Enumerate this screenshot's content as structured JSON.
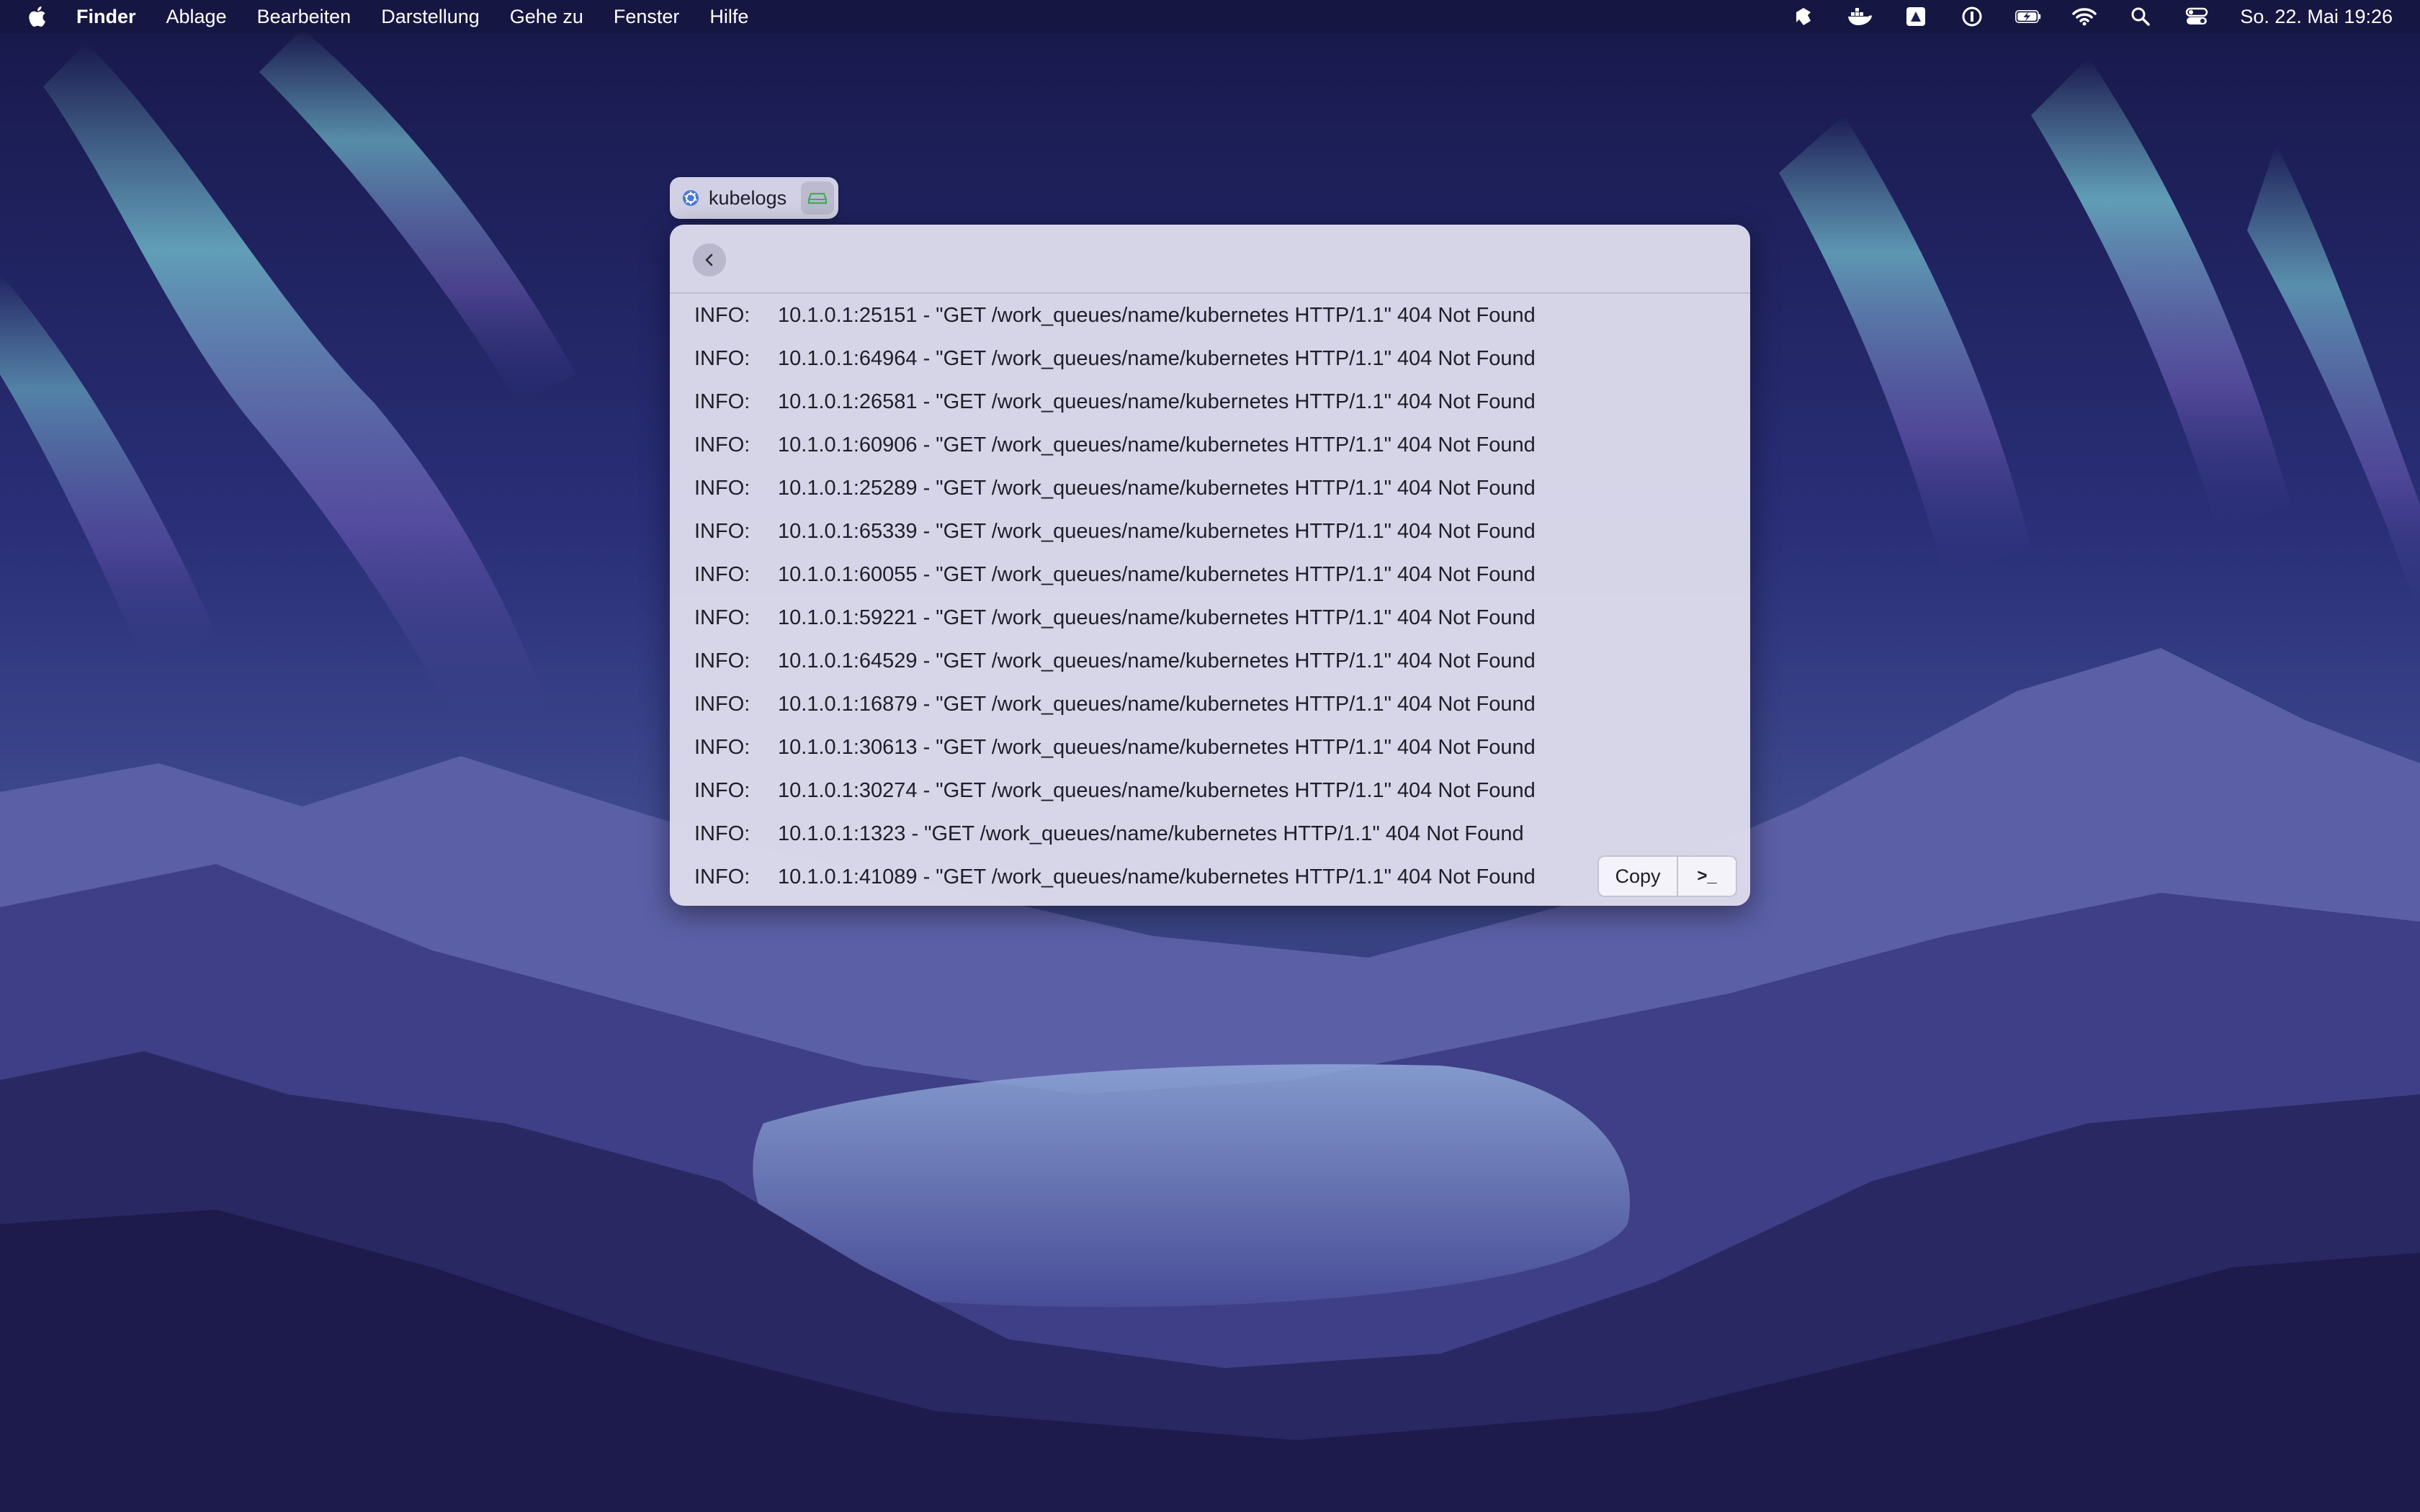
{
  "menubar": {
    "app_name": "Finder",
    "items": [
      "Ablage",
      "Bearbeiten",
      "Darstellung",
      "Gehe zu",
      "Fenster",
      "Hilfe"
    ],
    "clock": "So. 22. Mai  19:26",
    "status_icons": [
      "focus-icon",
      "docker-icon",
      "drive-icon",
      "password-manager-icon",
      "battery-icon",
      "wifi-icon",
      "spotlight-icon",
      "control-center-icon"
    ]
  },
  "app_tab": {
    "label": "kubelogs",
    "icon": "kubernetes-icon",
    "button_icon": "drive-icon"
  },
  "window": {
    "back_icon": "chevron-left-icon",
    "logs": [
      {
        "level": "INFO:",
        "message": "10.1.0.1:25151 - \"GET /work_queues/name/kubernetes HTTP/1.1\" 404 Not Found"
      },
      {
        "level": "INFO:",
        "message": "10.1.0.1:64964 - \"GET /work_queues/name/kubernetes HTTP/1.1\" 404 Not Found"
      },
      {
        "level": "INFO:",
        "message": "10.1.0.1:26581 - \"GET /work_queues/name/kubernetes HTTP/1.1\" 404 Not Found"
      },
      {
        "level": "INFO:",
        "message": "10.1.0.1:60906 - \"GET /work_queues/name/kubernetes HTTP/1.1\" 404 Not Found"
      },
      {
        "level": "INFO:",
        "message": "10.1.0.1:25289 - \"GET /work_queues/name/kubernetes HTTP/1.1\" 404 Not Found"
      },
      {
        "level": "INFO:",
        "message": "10.1.0.1:65339 - \"GET /work_queues/name/kubernetes HTTP/1.1\" 404 Not Found"
      },
      {
        "level": "INFO:",
        "message": "10.1.0.1:60055 - \"GET /work_queues/name/kubernetes HTTP/1.1\" 404 Not Found"
      },
      {
        "level": "INFO:",
        "message": "10.1.0.1:59221 - \"GET /work_queues/name/kubernetes HTTP/1.1\" 404 Not Found"
      },
      {
        "level": "INFO:",
        "message": "10.1.0.1:64529 - \"GET /work_queues/name/kubernetes HTTP/1.1\" 404 Not Found"
      },
      {
        "level": "INFO:",
        "message": "10.1.0.1:16879 - \"GET /work_queues/name/kubernetes HTTP/1.1\" 404 Not Found"
      },
      {
        "level": "INFO:",
        "message": "10.1.0.1:30613 - \"GET /work_queues/name/kubernetes HTTP/1.1\" 404 Not Found"
      },
      {
        "level": "INFO:",
        "message": "10.1.0.1:30274 - \"GET /work_queues/name/kubernetes HTTP/1.1\" 404 Not Found"
      },
      {
        "level": "INFO:",
        "message": "10.1.0.1:1323 - \"GET /work_queues/name/kubernetes HTTP/1.1\" 404 Not Found"
      },
      {
        "level": "INFO:",
        "message": "10.1.0.1:41089 - \"GET /work_queues/name/kubernetes HTTP/1.1\" 404 Not Found"
      }
    ],
    "copy_label": "Copy",
    "terminal_label": ">_"
  },
  "colors": {
    "accent": "#4a7bd8",
    "window_bg": "#dedcec",
    "sky_top": "#1a1b4e",
    "aurora": "#6fd6d8"
  }
}
